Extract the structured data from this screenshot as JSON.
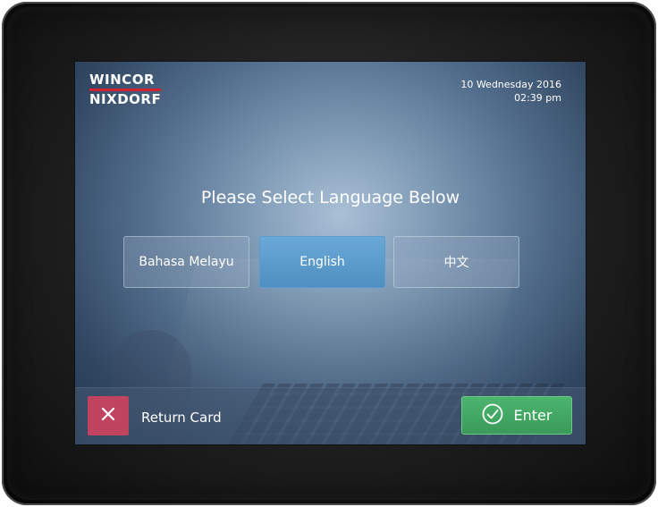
{
  "brand": {
    "line1": "WINCOR",
    "line2": "NIXDORF",
    "accent_color": "#d4212f"
  },
  "status": {
    "date": "10 Wednesday 2016",
    "time": "02:39 pm"
  },
  "main": {
    "heading": "Please Select Language Below",
    "languages": [
      {
        "label": "Bahasa Melayu",
        "selected": false
      },
      {
        "label": "English",
        "selected": true
      },
      {
        "label": "中文",
        "selected": false
      }
    ]
  },
  "footer": {
    "return_label": "Return Card",
    "return_icon": "close-icon",
    "return_color": "#c0445f",
    "enter_label": "Enter",
    "enter_icon": "check-circle-icon",
    "enter_color": "#3fa863"
  }
}
